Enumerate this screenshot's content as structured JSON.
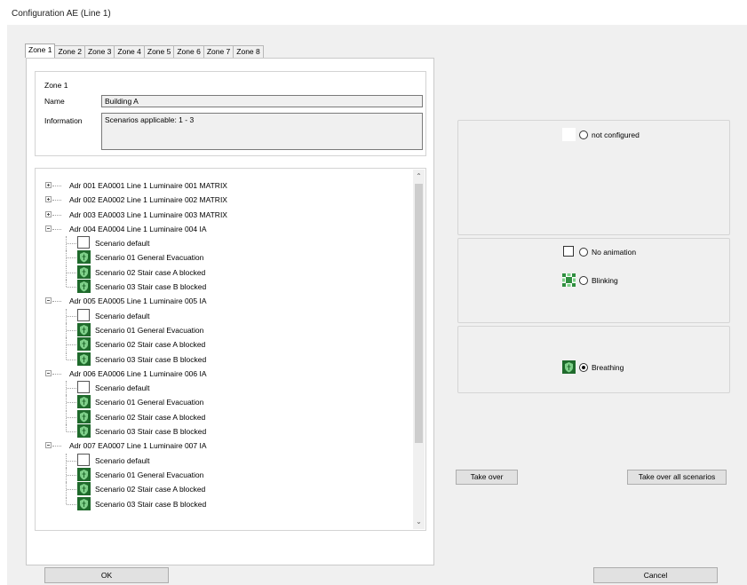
{
  "window": {
    "title": "Configuration AE (Line 1)"
  },
  "tabs": [
    "Zone 1",
    "Zone 2",
    "Zone 3",
    "Zone 4",
    "Zone 5",
    "Zone 6",
    "Zone 7",
    "Zone 8"
  ],
  "zone": {
    "header": "Zone 1",
    "name_label": "Name",
    "name_value": "Building A",
    "info_label": "Information",
    "info_value": "Scenarios applicable: 1 - 3"
  },
  "tree": {
    "rows": [
      {
        "kind": "lum",
        "expand": "plus",
        "text": "Adr  001  EA0001  Line 1 Luminaire 001  MATRIX"
      },
      {
        "kind": "lum",
        "expand": "plus",
        "text": "Adr  002  EA0002  Line 1 Luminaire 002  MATRIX"
      },
      {
        "kind": "lum",
        "expand": "plus",
        "text": "Adr  003  EA0003  Line 1 Luminaire 003  MATRIX"
      },
      {
        "kind": "lum",
        "expand": "minus",
        "text": "Adr  004  EA0004  Line 1 Luminaire 004  IA"
      },
      {
        "kind": "scn",
        "icon": "white",
        "text": "Scenario default"
      },
      {
        "kind": "scn",
        "icon": "green",
        "text": "Scenario 01   General Evacuation"
      },
      {
        "kind": "scn",
        "icon": "green",
        "text": "Scenario 02   Stair case A blocked"
      },
      {
        "kind": "scn",
        "icon": "green",
        "text": "Scenario 03   Stair case B blocked",
        "last": true
      },
      {
        "kind": "lum",
        "expand": "minus",
        "text": "Adr  005  EA0005  Line 1 Luminaire 005  IA"
      },
      {
        "kind": "scn",
        "icon": "white",
        "text": "Scenario default"
      },
      {
        "kind": "scn",
        "icon": "green",
        "text": "Scenario 01   General Evacuation"
      },
      {
        "kind": "scn",
        "icon": "green",
        "text": "Scenario 02   Stair case A blocked"
      },
      {
        "kind": "scn",
        "icon": "green",
        "text": "Scenario 03   Stair case B blocked",
        "last": true
      },
      {
        "kind": "lum",
        "expand": "minus",
        "text": "Adr  006  EA0006  Line 1 Luminaire 006  IA"
      },
      {
        "kind": "scn",
        "icon": "white",
        "text": "Scenario default"
      },
      {
        "kind": "scn",
        "icon": "green",
        "text": "Scenario 01   General Evacuation"
      },
      {
        "kind": "scn",
        "icon": "green",
        "text": "Scenario 02   Stair case A blocked"
      },
      {
        "kind": "scn",
        "icon": "green",
        "text": "Scenario 03   Stair case B blocked",
        "last": true
      },
      {
        "kind": "lum",
        "expand": "minus",
        "text": "Adr  007  EA0007  Line 1 Luminaire 007  IA"
      },
      {
        "kind": "scn",
        "icon": "white",
        "text": "Scenario default"
      },
      {
        "kind": "scn",
        "icon": "green",
        "text": "Scenario 01   General Evacuation"
      },
      {
        "kind": "scn",
        "icon": "green",
        "text": "Scenario 02   Stair case A blocked"
      },
      {
        "kind": "scn",
        "icon": "green",
        "text": "Scenario 03   Stair case B blocked",
        "last": true
      }
    ]
  },
  "options": {
    "not_configured": "not configured",
    "no_animation": "No animation",
    "blinking": "Blinking",
    "breathing": "Breathing",
    "selected": "Breathing"
  },
  "buttons": {
    "take_over": "Take over",
    "take_over_all": "Take over all scenarios",
    "ok": "OK",
    "cancel": "Cancel"
  },
  "colors": {
    "green": "#2f8f3f",
    "dark_green": "#1f6a2c",
    "light_green": "#7fd08a"
  }
}
